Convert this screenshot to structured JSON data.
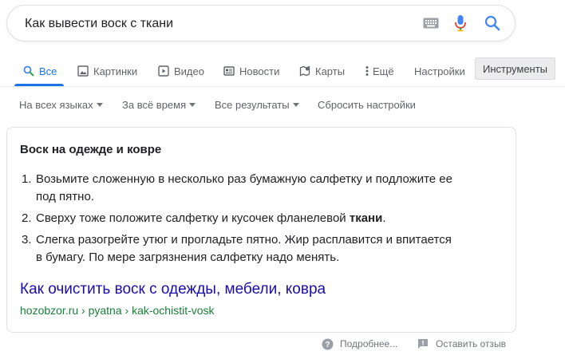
{
  "search": {
    "query": "Как вывести воск с ткани"
  },
  "tabs": [
    {
      "label": "Все",
      "icon": "search-icon",
      "active": true
    },
    {
      "label": "Картинки",
      "icon": "image-icon"
    },
    {
      "label": "Видео",
      "icon": "video-icon"
    },
    {
      "label": "Новости",
      "icon": "news-icon"
    },
    {
      "label": "Карты",
      "icon": "map-icon"
    },
    {
      "label": "Ещё",
      "icon": "more-vert-icon"
    },
    {
      "label": "Настройки"
    }
  ],
  "tools_button": "Инструменты",
  "filters": [
    {
      "label": "На всех языках"
    },
    {
      "label": "За всё время"
    },
    {
      "label": "Все результаты"
    },
    {
      "label": "Сбросить настройки"
    }
  ],
  "snippet": {
    "title": "Воск на одежде и ковре",
    "steps": [
      {
        "num": "1.",
        "line1": "Возьмите сложенную в несколько раз бумажную салфетку и подложите ее",
        "line2": "под пятно."
      },
      {
        "num": "2.",
        "pre": "Сверху тоже положите салфетку и кусочек фланелевой ",
        "bold": "ткани",
        "post": "."
      },
      {
        "num": "3.",
        "line1": "Слегка разогрейте утюг и прогладьте пятно. Жир расплавится и впитается",
        "line2": "в бумагу. По мере загрязнения салфетку надо менять."
      }
    ],
    "link_title": "Как очистить воск с одежды, мебели, ковра",
    "url": "hozobzor.ru › pyatna › kak-ochistit-vosk"
  },
  "footer": {
    "more_label": "Подробнее...",
    "feedback_label": "Оставить отзыв"
  },
  "colors": {
    "accent": "#1a73e8",
    "link": "#1a0dab",
    "url": "#188038"
  }
}
